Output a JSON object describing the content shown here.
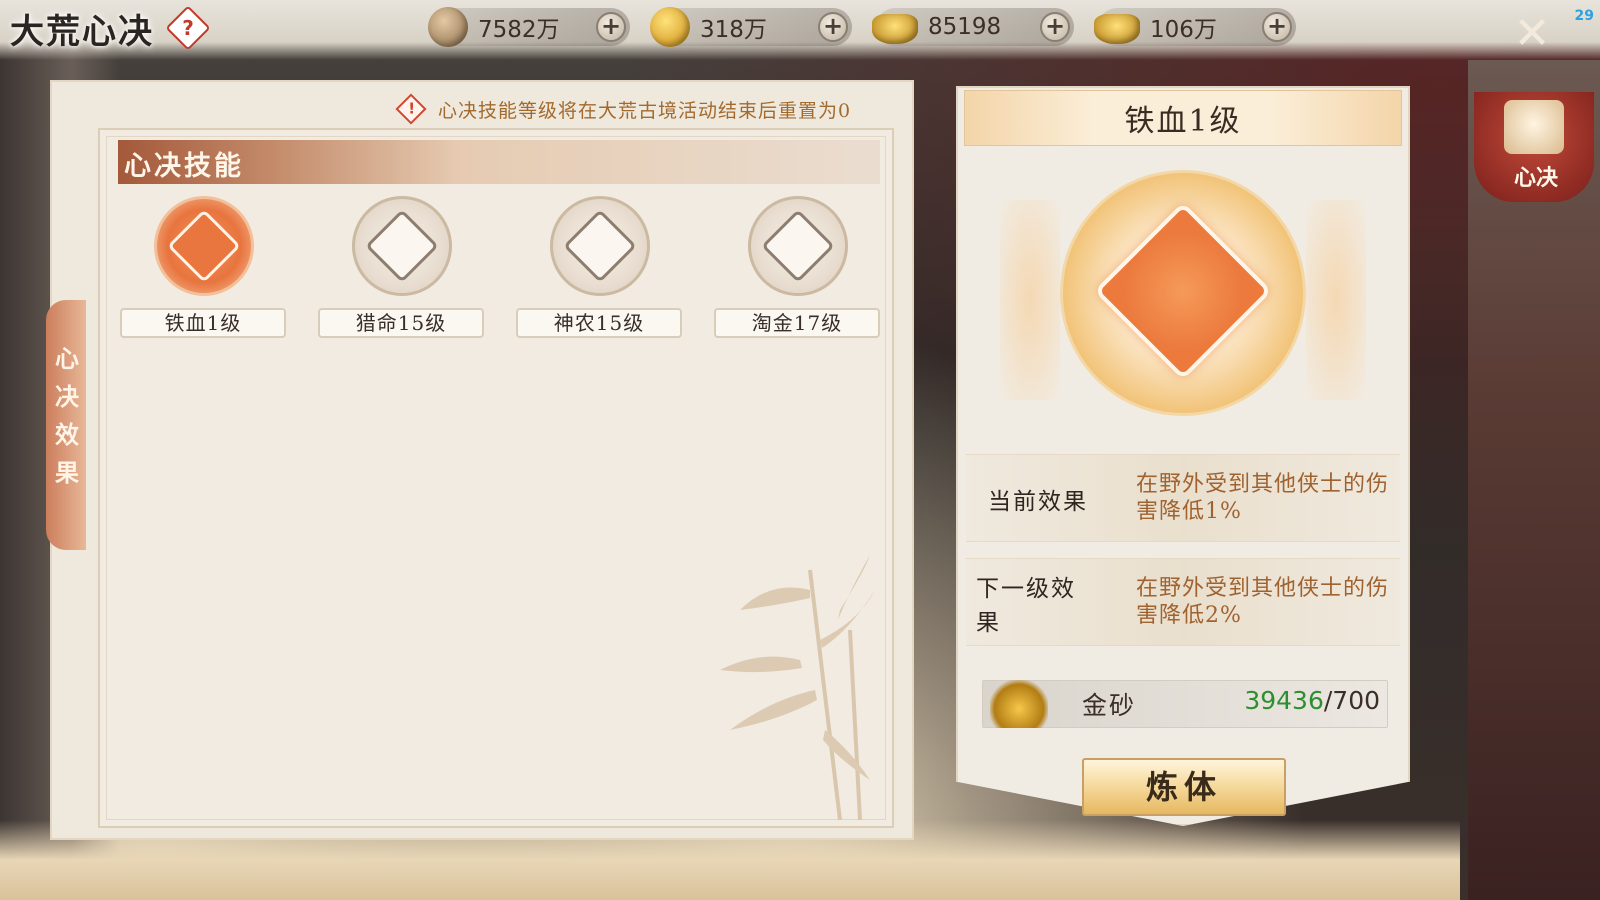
{
  "header": {
    "title": "大荒心决",
    "help_icon": "?",
    "fps": "29"
  },
  "currencies": [
    {
      "icon": "bronze-coin-icon",
      "value": "7582万"
    },
    {
      "icon": "gold-coin-icon",
      "value": "318万"
    },
    {
      "icon": "silver-ingot-icon",
      "value": "85198"
    },
    {
      "icon": "gold-ingot-icon",
      "value": "106万"
    }
  ],
  "side_tab": {
    "label": "心决"
  },
  "notice": {
    "icon": "warning-icon",
    "text": "心决技能等级将在大荒古境活动结束后重置为0"
  },
  "left_panel": {
    "section_title": "心决技能",
    "side_label": "心\n决\n效\n果",
    "skills": [
      {
        "label": "铁血1级",
        "active": true
      },
      {
        "label": "猎命15级",
        "active": false
      },
      {
        "label": "神农15级",
        "active": false
      },
      {
        "label": "淘金17级",
        "active": false
      }
    ]
  },
  "detail": {
    "title": "铁血1级",
    "current_effect_label": "当前效果",
    "current_effect_text": "在野外受到其他侠士的伤害降低1%",
    "next_effect_label": "下一级效果",
    "next_effect_text": "在野外受到其他侠士的伤害降低2%",
    "cost_name": "金砂",
    "cost_have": "39436",
    "cost_need": "/700",
    "action_label": "炼体"
  },
  "colors": {
    "accent": "#e8743e",
    "effect_text": "#a0622f",
    "have_green": "#2e8f31"
  }
}
